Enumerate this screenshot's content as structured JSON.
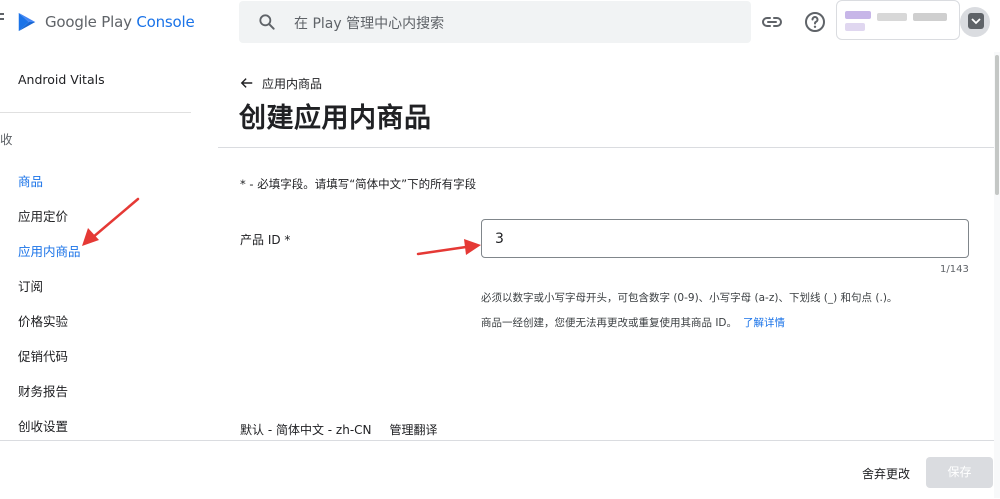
{
  "app": {
    "logo_text_google_play": "Google Play",
    "logo_text_console": "Console"
  },
  "search": {
    "placeholder": "在 Play 管理中心内搜索"
  },
  "sidebar": {
    "android_vitals": "Android Vitals",
    "section_fragment": "收",
    "items": [
      {
        "label": "商品",
        "active": true
      },
      {
        "label": "应用定价",
        "active": false
      },
      {
        "label": "应用内商品",
        "active": true
      },
      {
        "label": "订阅",
        "active": false
      },
      {
        "label": "价格实验",
        "active": false
      },
      {
        "label": "促销代码",
        "active": false
      },
      {
        "label": "财务报告",
        "active": false
      },
      {
        "label": "创收设置",
        "active": false
      }
    ]
  },
  "main": {
    "back_label": "应用内商品",
    "title": "创建应用内商品",
    "required_note": "* - 必填字段。请填写“简体中文”下的所有字段",
    "product_id_label": "产品 ID *",
    "product_id_value": "3",
    "char_count": "1/143",
    "help_text": "必须以数字或小写字母开头，可包含数字 (0-9)、小写字母 (a-z)、下划线 (_) 和句点 (.)。",
    "warning_text": "商品一经创建，您便无法再更改或重复使用其商品 ID。",
    "learn_more": "了解详情",
    "lang_default": "默认 - 简体中文 - zh-CN",
    "manage_translations": "管理翻译"
  },
  "footer": {
    "discard_label": "舍弃更改",
    "save_label": "保存"
  },
  "colors": {
    "accent": "#1a73e8",
    "annotation_arrow": "#e53935"
  }
}
